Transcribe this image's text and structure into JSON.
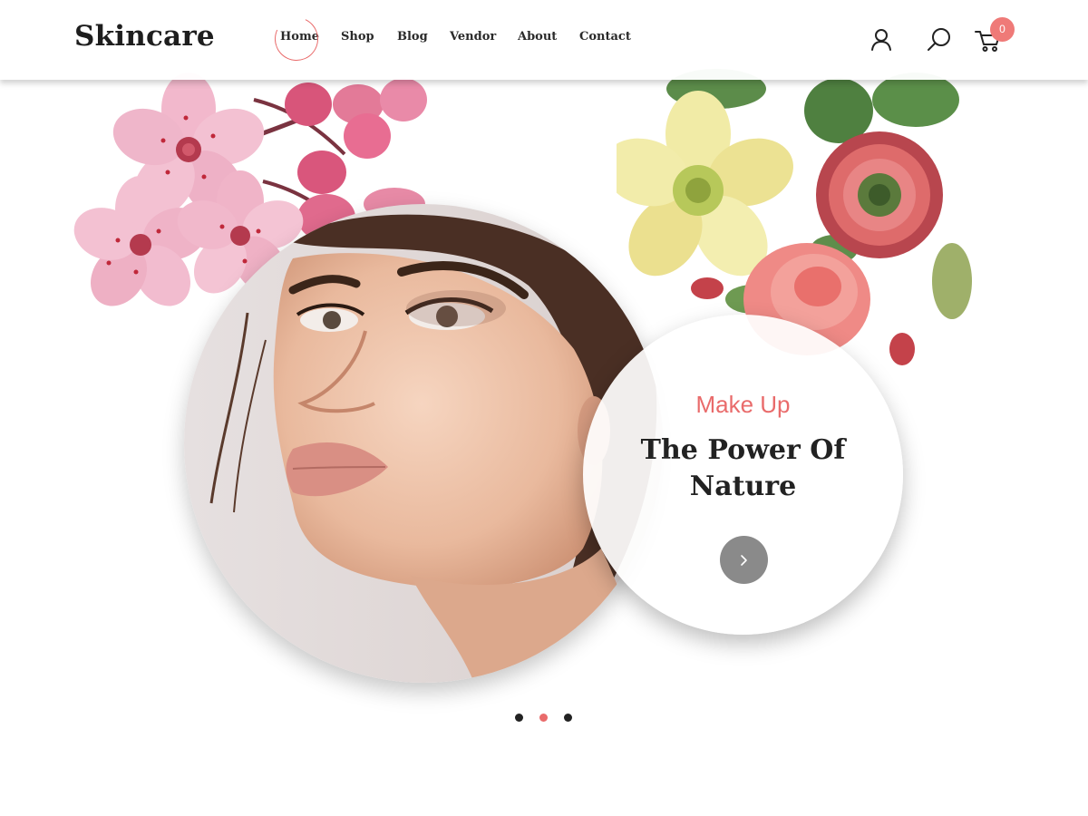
{
  "header": {
    "logo": "Skincare",
    "nav": [
      {
        "label": "Home",
        "active": true
      },
      {
        "label": "Shop",
        "active": false
      },
      {
        "label": "Blog",
        "active": false
      },
      {
        "label": "Vendor",
        "active": false
      },
      {
        "label": "About",
        "active": false
      },
      {
        "label": "Contact",
        "active": false
      }
    ],
    "icons": [
      "user-icon",
      "search-icon",
      "cart-icon"
    ],
    "cart_count": "0"
  },
  "hero": {
    "subtitle": "Make Up",
    "title": "The Power Of Nature",
    "next_icon": "chevron-right-icon"
  },
  "slider": {
    "total": 3,
    "active_index": 1
  },
  "colors": {
    "accent": "#e96b6b",
    "badge": "#ef7a78",
    "text": "#222222",
    "button": "#8a8a8a"
  }
}
